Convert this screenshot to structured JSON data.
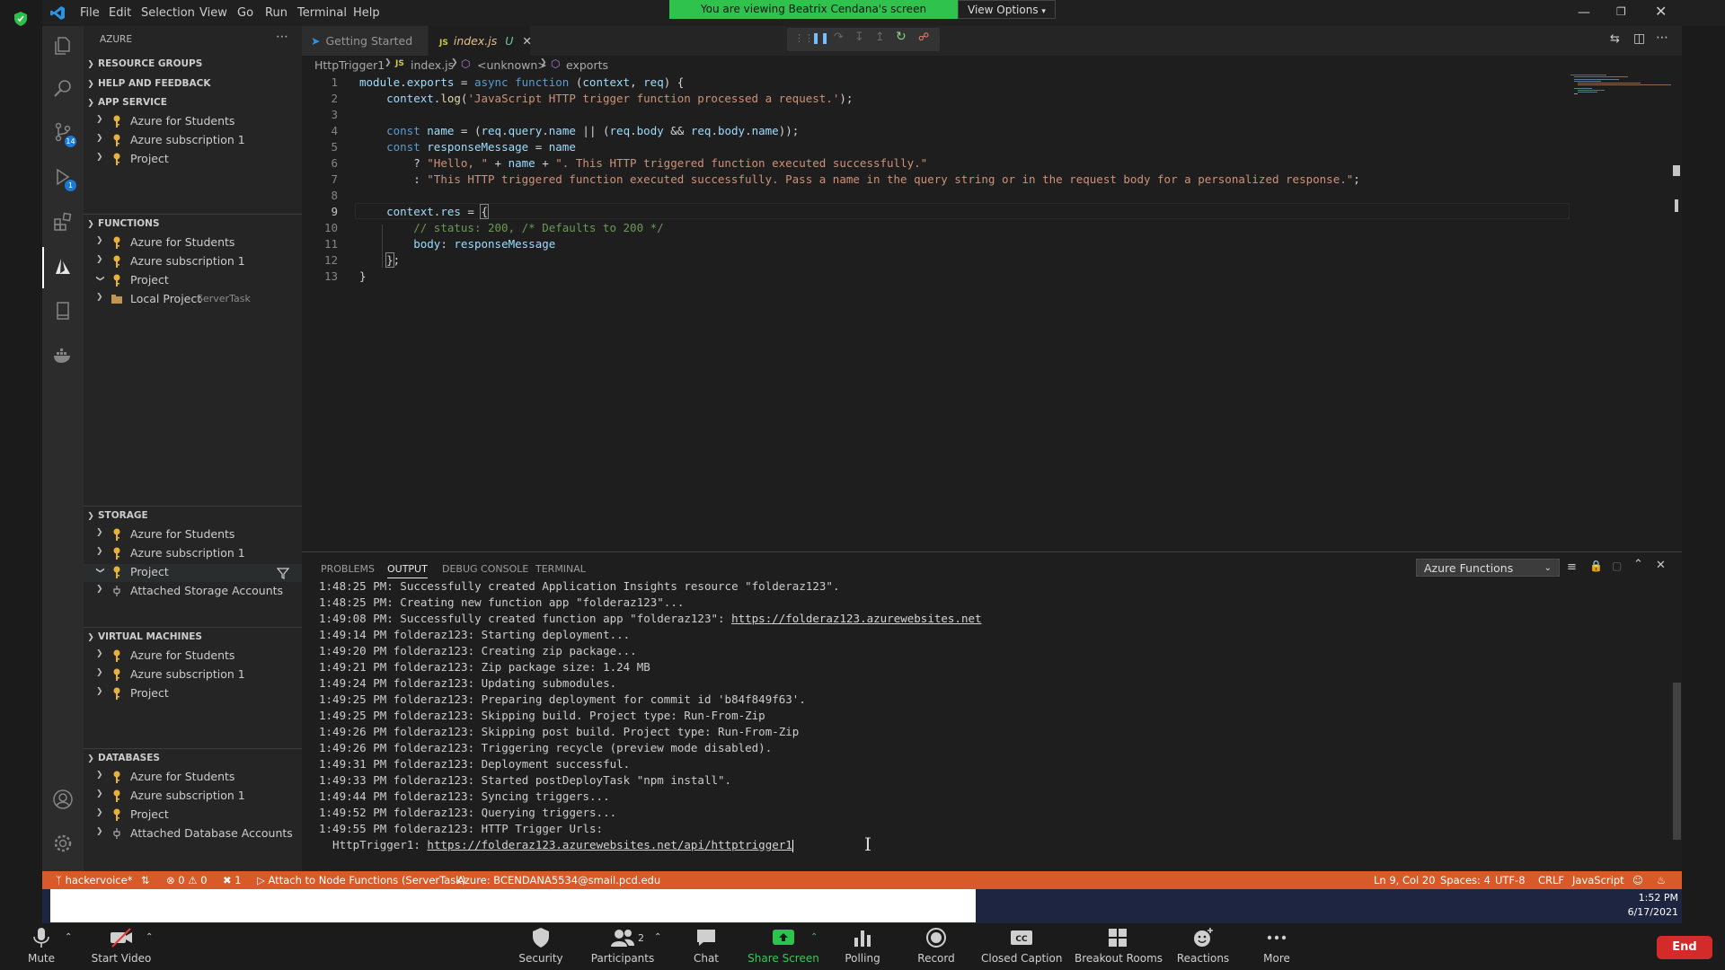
{
  "menu": [
    "File",
    "Edit",
    "Selection",
    "View",
    "Go",
    "Run",
    "Terminal",
    "Help"
  ],
  "share_banner": {
    "text": "You are viewing Beatrix Cendana's screen",
    "view_options": "View Options"
  },
  "sidebar": {
    "title": "AZURE",
    "sections": {
      "resource_groups": "RESOURCE GROUPS",
      "help": "HELP AND FEEDBACK",
      "app_service": {
        "label": "APP SERVICE",
        "items": [
          "Azure for Students",
          "Azure subscription 1",
          "Project"
        ]
      },
      "functions": {
        "label": "FUNCTIONS",
        "items": [
          "Azure for Students",
          "Azure subscription 1",
          "Project",
          "Local Project"
        ],
        "local_tag": "ServerTask"
      },
      "storage": {
        "label": "STORAGE",
        "items": [
          "Azure for Students",
          "Azure subscription 1",
          "Project",
          "Attached Storage Accounts"
        ]
      },
      "virtual_machines": {
        "label": "VIRTUAL MACHINES",
        "items": [
          "Azure for Students",
          "Azure subscription 1",
          "Project"
        ]
      },
      "databases": {
        "label": "DATABASES",
        "items": [
          "Azure for Students",
          "Azure subscription 1",
          "Project",
          "Attached Database Accounts"
        ]
      }
    }
  },
  "activity_badges": {
    "scm": "14",
    "debug": "1"
  },
  "tabs": [
    {
      "label": "Getting Started"
    },
    {
      "label": "index.js",
      "suffix": "U",
      "lang": "JS"
    }
  ],
  "breadcrumb": [
    "HttpTrigger1",
    "index.js",
    "<unknown>",
    "exports"
  ],
  "breadcrumb_js": "JS",
  "code_lines": [
    "1",
    "2",
    "3",
    "4",
    "5",
    "6",
    "7",
    "8",
    "9",
    "10",
    "11",
    "12",
    "13"
  ],
  "panel": {
    "tabs": [
      "PROBLEMS",
      "OUTPUT",
      "DEBUG CONSOLE",
      "TERMINAL"
    ],
    "output_source": "Azure Functions",
    "lines": [
      "1:48:25 PM: Successfully created Application Insights resource \"folderaz123\".",
      "1:48:25 PM: Creating new function app \"folderaz123\"...",
      "1:49:08 PM: Successfully created function app \"folderaz123\": ",
      "1:49:14 PM folderaz123: Starting deployment...",
      "1:49:20 PM folderaz123: Creating zip package...",
      "1:49:21 PM folderaz123: Zip package size: 1.24 MB",
      "1:49:24 PM folderaz123: Updating submodules.",
      "1:49:25 PM folderaz123: Preparing deployment for commit id 'b84f849f63'.",
      "1:49:25 PM folderaz123: Skipping build. Project type: Run-From-Zip",
      "1:49:26 PM folderaz123: Skipping post build. Project type: Run-From-Zip",
      "1:49:26 PM folderaz123: Triggering recycle (preview mode disabled).",
      "1:49:31 PM folderaz123: Deployment successful.",
      "1:49:33 PM folderaz123: Started postDeployTask \"npm install\".",
      "1:49:44 PM folderaz123: Syncing triggers...",
      "1:49:52 PM folderaz123: Querying triggers...",
      "1:49:55 PM folderaz123: HTTP Trigger Urls:",
      "  HttpTrigger1: "
    ],
    "app_url": "https://folderaz123.azurewebsites.net",
    "trigger_url": "https://folderaz123.azurewebsites.net/api/httptrigger1"
  },
  "statusbar": {
    "branch": "hackervoice*",
    "errors": "0",
    "warnings": "0",
    "x_count": "1",
    "attach": "Attach to Node Functions (ServerTask)",
    "account": "Azure: BCENDANA5534@smail.pcd.edu",
    "position": "Ln 9, Col 20",
    "spaces": "Spaces: 4",
    "encoding": "UTF-8",
    "eol": "CRLF",
    "language": "JavaScript"
  },
  "clock": {
    "time": "1:52 PM",
    "date": "6/17/2021"
  },
  "zoom": {
    "mute": "Mute",
    "video": "Start Video",
    "security": "Security",
    "participants": "Participants",
    "participant_count": "2",
    "chat": "Chat",
    "share": "Share Screen",
    "polling": "Polling",
    "record": "Record",
    "cc": "Closed Caption",
    "breakout": "Breakout Rooms",
    "reactions": "Reactions",
    "more": "More",
    "end": "End"
  },
  "colors": {
    "accent_status": "#d85a28",
    "share_green": "#2fc34d",
    "end_red": "#d32a2a"
  }
}
